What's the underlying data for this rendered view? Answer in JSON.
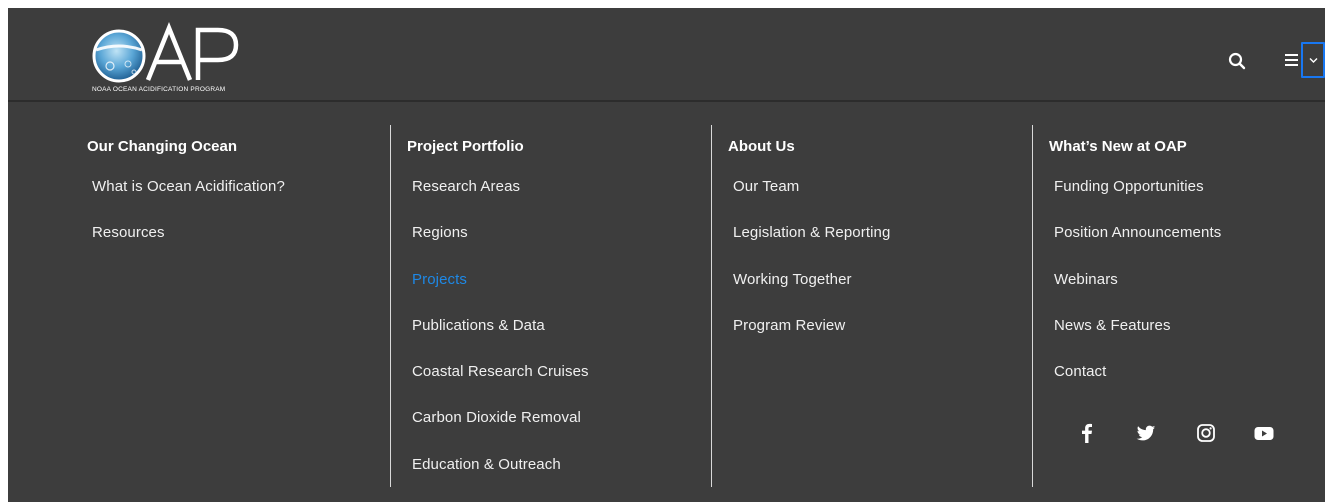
{
  "header": {
    "logo_text": "OAP",
    "logo_subtitle": "NOAA OCEAN ACIDIFICATION PROGRAM",
    "icons": [
      "search-icon",
      "hamburger-menu-icon",
      "chevron-down-icon"
    ]
  },
  "menu": {
    "columns": [
      {
        "heading": "Our Changing Ocean",
        "items": [
          {
            "label": "What is Ocean Acidification?"
          },
          {
            "label": "Resources"
          }
        ]
      },
      {
        "heading": "Project Portfolio",
        "items": [
          {
            "label": "Research Areas"
          },
          {
            "label": "Regions"
          },
          {
            "label": "Projects",
            "active": true
          },
          {
            "label": "Publications & Data"
          },
          {
            "label": "Coastal Research Cruises"
          },
          {
            "label": "Carbon Dioxide Removal"
          },
          {
            "label": "Education & Outreach"
          }
        ]
      },
      {
        "heading": "About Us",
        "items": [
          {
            "label": "Our Team"
          },
          {
            "label": "Legislation & Reporting"
          },
          {
            "label": "Working Together"
          },
          {
            "label": "Program Review"
          }
        ]
      },
      {
        "heading": "What’s New at OAP",
        "items": [
          {
            "label": "Funding Opportunities"
          },
          {
            "label": "Position Announcements"
          },
          {
            "label": "Webinars"
          },
          {
            "label": "News & Features"
          },
          {
            "label": "Contact"
          }
        ]
      }
    ]
  },
  "social": [
    "facebook-icon",
    "twitter-icon",
    "instagram-icon",
    "youtube-icon"
  ],
  "colors": {
    "background": "#3d3d3d",
    "text": "#ffffff",
    "active_link": "#1e88e5",
    "focus_outline": "#1877f2",
    "divider": "#d9d9d9"
  }
}
